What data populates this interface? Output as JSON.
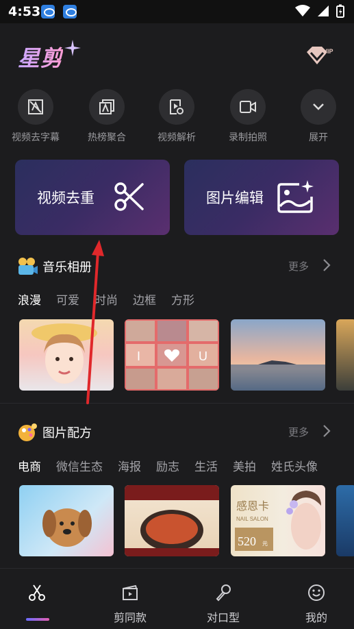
{
  "status_bar": {
    "time": "4:53"
  },
  "header": {
    "logo_text": "星剪",
    "vip_badge": "VIP"
  },
  "tools": [
    {
      "label": "视频去字幕",
      "icon": "no-subtitle-icon"
    },
    {
      "label": "热榜聚合",
      "icon": "hot-list-icon"
    },
    {
      "label": "视频解析",
      "icon": "video-parse-icon"
    },
    {
      "label": "录制拍照",
      "icon": "camera-record-icon"
    },
    {
      "label": "展开",
      "icon": "chevron-down-icon"
    }
  ],
  "features": [
    {
      "label": "视频去重",
      "icon": "scissors-icon"
    },
    {
      "label": "图片编辑",
      "icon": "image-edit-icon"
    }
  ],
  "music_album": {
    "title": "音乐相册",
    "more": "更多",
    "chips": [
      "浪漫",
      "可爱",
      "时尚",
      "边框",
      "方形"
    ],
    "thumb_text": {
      "left": "I",
      "right": "U"
    }
  },
  "image_recipe": {
    "title": "图片配方",
    "more": "更多",
    "chips": [
      "电商",
      "微信生态",
      "海报",
      "励志",
      "生活",
      "美拍",
      "姓氏头像"
    ],
    "thumb_text": {
      "card_title": "感恩卡",
      "card_sub": "NAIL SALON",
      "card_price": "520",
      "card_unit": "元"
    }
  },
  "bottom_nav": [
    {
      "label": "",
      "icon": "scissors-icon"
    },
    {
      "label": "剪同款",
      "icon": "clapper-icon"
    },
    {
      "label": "对口型",
      "icon": "microphone-icon"
    },
    {
      "label": "我的",
      "icon": "smiley-icon"
    }
  ],
  "colors": {
    "background": "#1c1c1e",
    "card_gradient_start": "#2b2f5e",
    "card_gradient_end": "#5a2f6f",
    "annotation_arrow": "#e0282b"
  }
}
